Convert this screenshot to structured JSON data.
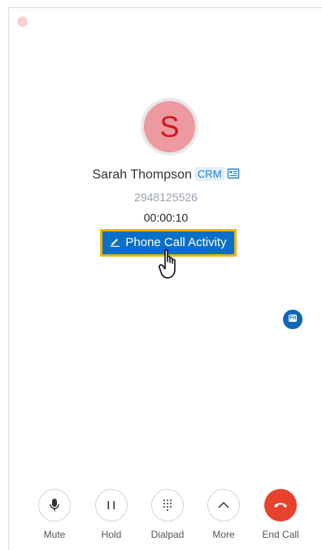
{
  "contact": {
    "initial": "S",
    "name": "Sarah Thompson",
    "crm_badge": "CRM",
    "number": "2948125526",
    "duration": "00:00:10"
  },
  "actions": {
    "activity_button_label": "Phone Call Activity",
    "fn_badge": "Fn"
  },
  "controls": {
    "mute": "Mute",
    "hold": "Hold",
    "dialpad": "Dialpad",
    "more": "More",
    "end_call": "End Call"
  },
  "colors": {
    "accent": "#0a6fc6",
    "highlight": "#f0b30a",
    "avatar_bg": "#ec9aa0",
    "avatar_text": "#d2161e",
    "end_call": "#e8412e"
  },
  "icons": [
    "close-dot",
    "contact-card-icon",
    "pencil-icon",
    "hand-cursor-icon",
    "fn-icon",
    "microphone-icon",
    "pause-icon",
    "dialpad-icon",
    "chevron-up-icon",
    "hang-up-icon"
  ]
}
